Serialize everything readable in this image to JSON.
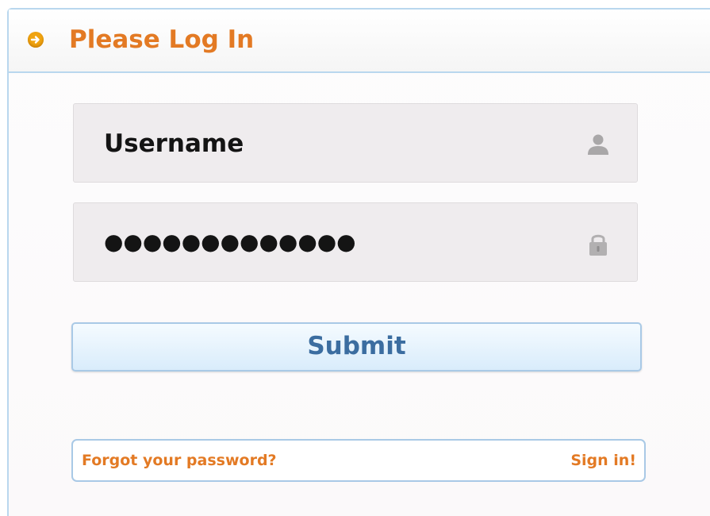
{
  "header": {
    "title": "Please Log In",
    "icon": "arrow-right-circle-icon",
    "accent_color": "#e37a24"
  },
  "form": {
    "username": {
      "value": "Username",
      "icon": "user-icon"
    },
    "password": {
      "value": "●●●●●●●●●●●●●",
      "icon": "lock-icon"
    },
    "submit_label": "Submit"
  },
  "footer": {
    "forgot_label": "Forgot your password?",
    "signin_label": "Sign in!"
  }
}
